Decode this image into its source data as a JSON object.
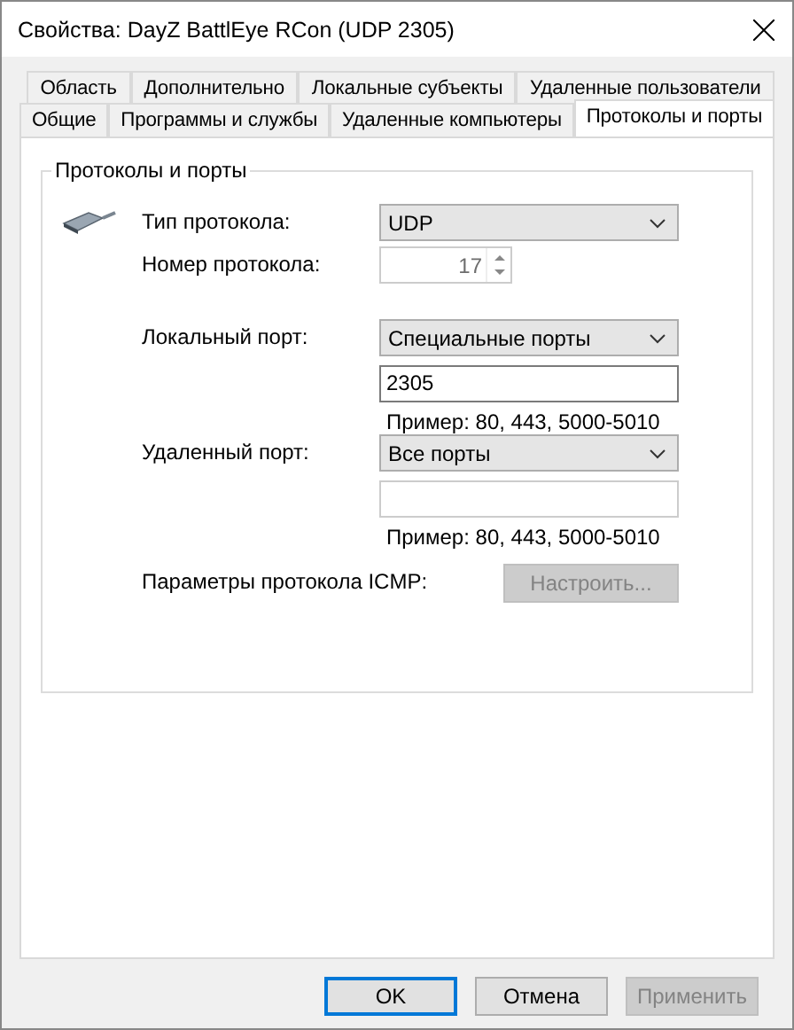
{
  "window": {
    "title": "Свойства: DayZ BattlEye RCon (UDP 2305)"
  },
  "tab_rows": [
    [
      {
        "label": "Область",
        "selected": false
      },
      {
        "label": "Дополнительно",
        "selected": false
      },
      {
        "label": "Локальные субъекты",
        "selected": false
      },
      {
        "label": "Удаленные пользователи",
        "selected": false
      }
    ],
    [
      {
        "label": "Общие",
        "selected": false
      },
      {
        "label": "Программы и службы",
        "selected": false
      },
      {
        "label": "Удаленные компьютеры",
        "selected": false
      },
      {
        "label": "Протоколы и порты",
        "selected": true
      }
    ]
  ],
  "group": {
    "title": "Протоколы и порты",
    "rows": [
      {
        "kind": "dropdown",
        "label": "Тип протокола:",
        "value": "UDP",
        "disabled": false
      },
      {
        "kind": "spinner",
        "label": "Номер протокола:",
        "value": "17",
        "disabled": true
      },
      {
        "kind": "dropdown",
        "label": "Локальный порт:",
        "value": "Специальные порты",
        "disabled": false,
        "input_value": "2305",
        "input_disabled": false,
        "hint": "Пример: 80, 443, 5000-5010"
      },
      {
        "kind": "dropdown",
        "label": "Удаленный порт:",
        "value": "Все порты",
        "disabled": false,
        "input_disabled": true,
        "hint": "Пример: 80, 443, 5000-5010"
      },
      {
        "kind": "button",
        "label": "Параметры протокола ICMP:",
        "value": "Настроить...",
        "disabled": true
      }
    ]
  },
  "buttons": [
    {
      "label": "OK",
      "default": true,
      "disabled": false
    },
    {
      "label": "Отмена",
      "default": false,
      "disabled": false
    },
    {
      "label": "Применить",
      "default": false,
      "disabled": true
    }
  ]
}
